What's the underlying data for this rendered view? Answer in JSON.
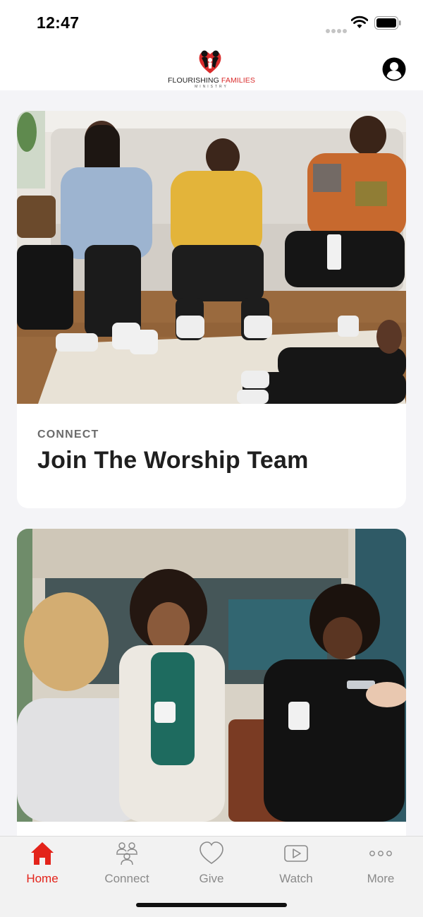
{
  "status_bar": {
    "time": "12:47"
  },
  "header": {
    "logo": {
      "name_part1": "FLOURISHING",
      "name_part2": "FAMILIES",
      "subtitle": "MINISTRY"
    },
    "profile_icon": "profile-icon"
  },
  "feed": {
    "cards": [
      {
        "category": "CONNECT",
        "title": "Join The Worship Team",
        "image": "photo-people-on-couch"
      },
      {
        "category": "",
        "title": "",
        "image": "photo-women-with-coffee"
      }
    ]
  },
  "tab_bar": {
    "items": [
      {
        "label": "Home",
        "icon": "home-icon",
        "active": true
      },
      {
        "label": "Connect",
        "icon": "group-icon",
        "active": false
      },
      {
        "label": "Give",
        "icon": "heart-icon",
        "active": false
      },
      {
        "label": "Watch",
        "icon": "play-icon",
        "active": false
      },
      {
        "label": "More",
        "icon": "more-icon",
        "active": false
      }
    ]
  },
  "colors": {
    "accent": "#e3231a",
    "inactive": "#8a8a8a",
    "background": "#f4f4f7"
  }
}
